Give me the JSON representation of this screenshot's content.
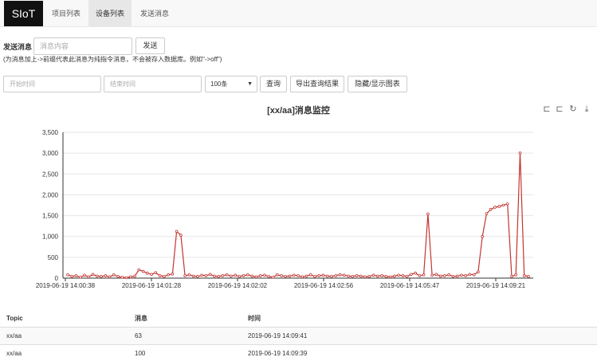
{
  "nav": {
    "brand": "SIoT",
    "items": [
      {
        "label": "项目列表",
        "active": false
      },
      {
        "label": "设备列表",
        "active": true
      },
      {
        "label": "发送消息",
        "active": false
      }
    ]
  },
  "send": {
    "label": "发送消息",
    "input_placeholder": "消息内容",
    "button": "发送",
    "hint": "(为消息加上->前缀代表此消息为纯指令消息，不会被存入数据库。例如\"->off\")"
  },
  "query": {
    "start_placeholder": "开始时间",
    "end_placeholder": "结束时间",
    "limit_value": "100条",
    "query_button": "查询",
    "export_button": "导出查询结果",
    "toggle_button": "隐藏/显示图表"
  },
  "toolbox": {
    "icons": [
      "zoom-icon",
      "zoom-reset-icon",
      "restore-icon",
      "download-icon"
    ],
    "glyphs": [
      "⊏",
      "⊏",
      "↻",
      "⤓"
    ]
  },
  "chart_data": {
    "type": "line",
    "title": "[xx/aa]消息监控",
    "ylim": [
      0,
      3500
    ],
    "yticks": [
      "0",
      "500",
      "1,000",
      "1,500",
      "2,000",
      "2,500",
      "3,000",
      "3,500"
    ],
    "xticks": [
      "2019-06-19 14:00:38",
      "2019-06-19 14:01:28",
      "2019-06-19 14:02:02",
      "2019-06-19 14:02:56",
      "2019-06-19 14:05:47",
      "2019-06-19 14:09:21"
    ],
    "grid": true,
    "color": "#c23531",
    "values": [
      80,
      40,
      60,
      20,
      70,
      30,
      90,
      50,
      40,
      60,
      30,
      80,
      40,
      20,
      10,
      30,
      50,
      200,
      160,
      120,
      90,
      130,
      60,
      40,
      80,
      100,
      1120,
      1030,
      60,
      80,
      50,
      40,
      70,
      60,
      90,
      50,
      40,
      60,
      80,
      50,
      70,
      40,
      60,
      80,
      50,
      30,
      60,
      70,
      40,
      20,
      80,
      60,
      40,
      50,
      70,
      60,
      30,
      50,
      80,
      40,
      60,
      70,
      50,
      40,
      60,
      80,
      70,
      50,
      40,
      60,
      50,
      30,
      40,
      70,
      50,
      60,
      40,
      30,
      50,
      70,
      60,
      40,
      90,
      120,
      60,
      80,
      1540,
      70,
      90,
      50,
      60,
      80,
      40,
      50,
      70,
      60,
      90,
      80,
      150,
      1000,
      1550,
      1650,
      1700,
      1720,
      1750,
      1780,
      40,
      80,
      3000,
      60,
      40
    ]
  },
  "table": {
    "headers": [
      "Topic",
      "消息",
      "时间"
    ],
    "rows": [
      {
        "topic": "xx/aa",
        "message": "63",
        "time": "2019-06-19 14:09:41"
      },
      {
        "topic": "xx/aa",
        "message": "100",
        "time": "2019-06-19 14:09:39"
      }
    ]
  }
}
